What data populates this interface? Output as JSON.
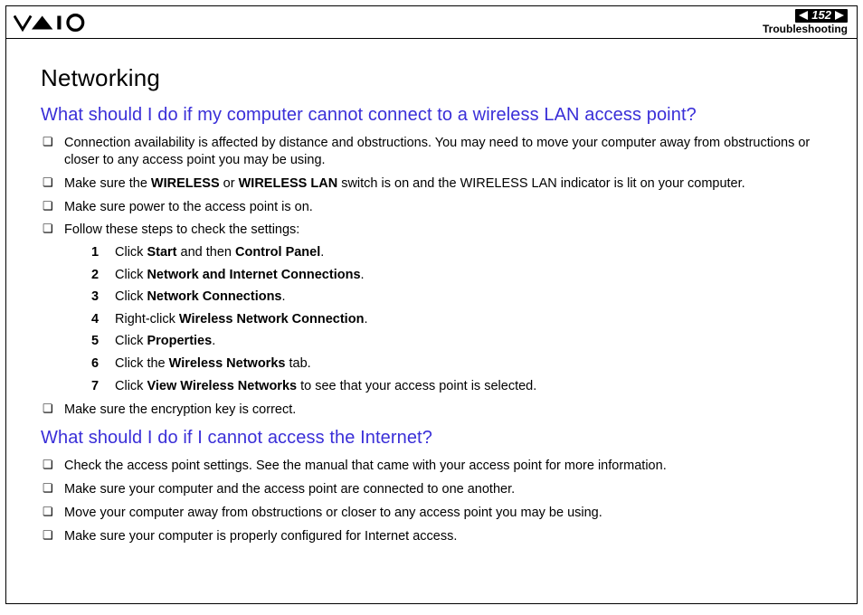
{
  "header": {
    "page_number": "152",
    "section": "Troubleshooting"
  },
  "content": {
    "title": "Networking",
    "q1": {
      "heading": "What should I do if my computer cannot connect to a wireless LAN access point?",
      "b1": "Connection availability is affected by distance and obstructions. You may need to move your computer away from obstructions or closer to any access point you may be using.",
      "b2_pre": "Make sure the ",
      "b2_bold1": "WIRELESS",
      "b2_mid1": " or ",
      "b2_bold2": "WIRELESS LAN",
      "b2_post": " switch is on and the WIRELESS LAN indicator is lit on your computer.",
      "b3": "Make sure power to the access point is on.",
      "b4": "Follow these steps to check the settings:",
      "s1_pre": "Click ",
      "s1_b1": "Start",
      "s1_mid": " and then ",
      "s1_b2": "Control Panel",
      "s1_post": ".",
      "s2_pre": "Click ",
      "s2_b1": "Network and Internet Connections",
      "s2_post": ".",
      "s3_pre": "Click ",
      "s3_b1": "Network Connections",
      "s3_post": ".",
      "s4_pre": "Right-click ",
      "s4_b1": "Wireless Network Connection",
      "s4_post": ".",
      "s5_pre": "Click ",
      "s5_b1": "Properties",
      "s5_post": ".",
      "s6_pre": "Click the ",
      "s6_b1": "Wireless Networks",
      "s6_post": " tab.",
      "s7_pre": "Click ",
      "s7_b1": "View Wireless Networks",
      "s7_post": " to see that your access point is selected.",
      "b5": "Make sure the encryption key is correct."
    },
    "q2": {
      "heading": "What should I do if I cannot access the Internet?",
      "b1": "Check the access point settings. See the manual that came with your access point for more information.",
      "b2": "Make sure your computer and the access point are connected to one another.",
      "b3": "Move your computer away from obstructions or closer to any access point you may be using.",
      "b4": "Make sure your computer is properly configured for Internet access."
    }
  }
}
